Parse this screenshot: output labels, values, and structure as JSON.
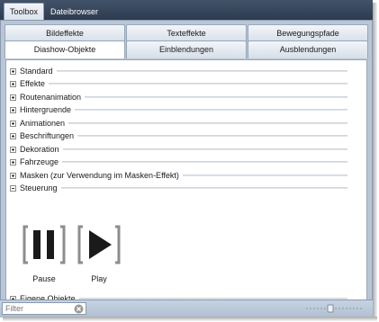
{
  "window_tabs": [
    {
      "label": "Toolbox",
      "active": true
    },
    {
      "label": "Dateibrowser",
      "active": false
    }
  ],
  "tabs_row1": [
    {
      "label": "Bildeffekte"
    },
    {
      "label": "Texteffekte"
    },
    {
      "label": "Bewegungspfade"
    }
  ],
  "tabs_row2": [
    {
      "label": "Diashow-Objekte",
      "selected": true
    },
    {
      "label": "Einblendungen",
      "selected": false
    },
    {
      "label": "Ausblendungen",
      "selected": false
    }
  ],
  "categories": [
    {
      "label": "Standard",
      "expanded": false
    },
    {
      "label": "Effekte",
      "expanded": false
    },
    {
      "label": "Routenanimation",
      "expanded": false
    },
    {
      "label": "Hintergruende",
      "expanded": false
    },
    {
      "label": "Animationen",
      "expanded": false
    },
    {
      "label": "Beschriftungen",
      "expanded": false
    },
    {
      "label": "Dekoration",
      "expanded": false
    },
    {
      "label": "Fahrzeuge",
      "expanded": false
    },
    {
      "label": "Masken (zur Verwendung im Masken-Effekt)",
      "expanded": false
    },
    {
      "label": "Steuerung",
      "expanded": true
    }
  ],
  "steuerung_items": [
    {
      "label": "Pause",
      "icon": "pause-icon"
    },
    {
      "label": "Play",
      "icon": "play-icon"
    }
  ],
  "last_category": {
    "label": "Eigene Objekte",
    "expanded": false
  },
  "filter": {
    "placeholder": "Filter",
    "value": ""
  },
  "colors": {
    "titlebar": "#2d3b4e",
    "panel": "#b9c6d6",
    "icon_dark": "#1a1a1a",
    "icon_bracket": "#8d8d8d"
  }
}
